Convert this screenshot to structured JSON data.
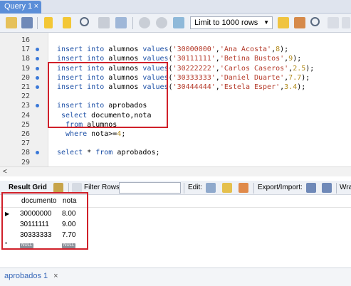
{
  "tab": {
    "title": "Query 1",
    "close": "×"
  },
  "toolbar": {
    "limit_label": "Limit to 1000 rows",
    "icons": [
      "folder-icon",
      "save-icon",
      "lightning-icon",
      "lightning-cursor-icon",
      "magnifier-icon",
      "stop-icon",
      "toggle-icon",
      "commit-icon",
      "rollback-icon",
      "beautify-icon",
      "find-icon",
      "invisible-chars-icon",
      "wrap-icon"
    ]
  },
  "editor": {
    "lines": [
      {
        "num": "16",
        "dot": false,
        "tokens": []
      },
      {
        "num": "17",
        "dot": true,
        "tokens": [
          {
            "t": "insert into ",
            "c": "kw"
          },
          {
            "t": "alumnos ",
            "c": "plain"
          },
          {
            "t": "values",
            "c": "kw"
          },
          {
            "t": "(",
            "c": "plain"
          },
          {
            "t": "'30000000'",
            "c": "str"
          },
          {
            "t": ",",
            "c": "plain"
          },
          {
            "t": "'Ana Acosta'",
            "c": "str"
          },
          {
            "t": ",",
            "c": "plain"
          },
          {
            "t": "8",
            "c": "num"
          },
          {
            "t": ");",
            "c": "plain"
          }
        ]
      },
      {
        "num": "18",
        "dot": true,
        "tokens": [
          {
            "t": "insert into ",
            "c": "kw"
          },
          {
            "t": "alumnos ",
            "c": "plain"
          },
          {
            "t": "values",
            "c": "kw"
          },
          {
            "t": "(",
            "c": "plain"
          },
          {
            "t": "'30111111'",
            "c": "str"
          },
          {
            "t": ",",
            "c": "plain"
          },
          {
            "t": "'Betina Bustos'",
            "c": "str"
          },
          {
            "t": ",",
            "c": "plain"
          },
          {
            "t": "9",
            "c": "num"
          },
          {
            "t": ");",
            "c": "plain"
          }
        ]
      },
      {
        "num": "19",
        "dot": true,
        "tokens": [
          {
            "t": "insert into ",
            "c": "kw"
          },
          {
            "t": "alumnos ",
            "c": "plain"
          },
          {
            "t": "values",
            "c": "kw"
          },
          {
            "t": "(",
            "c": "plain"
          },
          {
            "t": "'30222222'",
            "c": "str"
          },
          {
            "t": ",",
            "c": "plain"
          },
          {
            "t": "'Carlos Caseros'",
            "c": "str"
          },
          {
            "t": ",",
            "c": "plain"
          },
          {
            "t": "2.5",
            "c": "num"
          },
          {
            "t": ");",
            "c": "plain"
          }
        ]
      },
      {
        "num": "20",
        "dot": true,
        "tokens": [
          {
            "t": "insert into ",
            "c": "kw"
          },
          {
            "t": "alumnos ",
            "c": "plain"
          },
          {
            "t": "values",
            "c": "kw"
          },
          {
            "t": "(",
            "c": "plain"
          },
          {
            "t": "'30333333'",
            "c": "str"
          },
          {
            "t": ",",
            "c": "plain"
          },
          {
            "t": "'Daniel Duarte'",
            "c": "str"
          },
          {
            "t": ",",
            "c": "plain"
          },
          {
            "t": "7.7",
            "c": "num"
          },
          {
            "t": ");",
            "c": "plain"
          }
        ]
      },
      {
        "num": "21",
        "dot": true,
        "tokens": [
          {
            "t": "insert into ",
            "c": "kw"
          },
          {
            "t": "alumnos ",
            "c": "plain"
          },
          {
            "t": "values",
            "c": "kw"
          },
          {
            "t": "(",
            "c": "plain"
          },
          {
            "t": "'30444444'",
            "c": "str"
          },
          {
            "t": ",",
            "c": "plain"
          },
          {
            "t": "'Estela Esper'",
            "c": "str"
          },
          {
            "t": ",",
            "c": "plain"
          },
          {
            "t": "3.4",
            "c": "num"
          },
          {
            "t": ");",
            "c": "plain"
          }
        ]
      },
      {
        "num": "22",
        "dot": false,
        "tokens": []
      },
      {
        "num": "23",
        "dot": true,
        "tokens": [
          {
            "t": "insert into ",
            "c": "kw"
          },
          {
            "t": "aprobados",
            "c": "plain"
          }
        ]
      },
      {
        "num": "24",
        "dot": false,
        "tokens": [
          {
            "t": " select ",
            "c": "kw"
          },
          {
            "t": "documento,nota",
            "c": "plain"
          }
        ]
      },
      {
        "num": "25",
        "dot": false,
        "tokens": [
          {
            "t": "  from ",
            "c": "kw"
          },
          {
            "t": "alumnos",
            "c": "plain"
          }
        ]
      },
      {
        "num": "26",
        "dot": false,
        "tokens": [
          {
            "t": "  where ",
            "c": "kw"
          },
          {
            "t": "nota>=",
            "c": "plain"
          },
          {
            "t": "4",
            "c": "num"
          },
          {
            "t": ";",
            "c": "plain"
          }
        ]
      },
      {
        "num": "27",
        "dot": false,
        "tokens": []
      },
      {
        "num": "28",
        "dot": true,
        "tokens": [
          {
            "t": "select ",
            "c": "kw"
          },
          {
            "t": "* ",
            "c": "plain"
          },
          {
            "t": "from ",
            "c": "kw"
          },
          {
            "t": "aprobados;",
            "c": "plain"
          }
        ]
      },
      {
        "num": "29",
        "dot": false,
        "tokens": []
      }
    ]
  },
  "result_toolbar": {
    "result_grid_label": "Result Grid",
    "filter_label": "Filter Rows:",
    "filter_value": "",
    "edit_label": "Edit:",
    "export_label": "Export/Import:",
    "wrap_label": "Wra"
  },
  "grid": {
    "columns": [
      "documento",
      "nota"
    ],
    "rows": [
      {
        "marker": "▶",
        "documento": "30000000",
        "nota": "8.00"
      },
      {
        "marker": "",
        "documento": "30111111",
        "nota": "9.00"
      },
      {
        "marker": "",
        "documento": "30333333",
        "nota": "7.70"
      }
    ],
    "null_row": {
      "marker": "*",
      "documento": "NULL",
      "nota": "NULL"
    }
  },
  "bottom_tab": {
    "label": "aprobados 1",
    "close": "×"
  },
  "colors": {
    "tab_bg": "#5b8ed8",
    "highlight_red": "#d0202a",
    "keyword": "#1c4fa6",
    "string": "#b53b2b",
    "number": "#b28b1e"
  }
}
